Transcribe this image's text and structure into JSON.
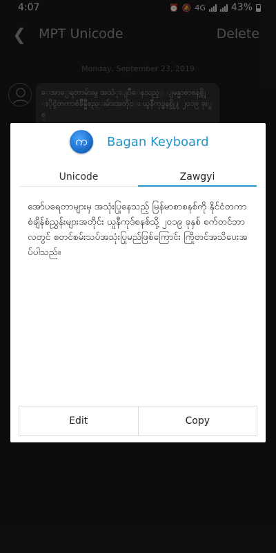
{
  "status_bar": {
    "time": "4:07",
    "network": "4G",
    "battery": "43%"
  },
  "app_bar": {
    "back_icon": "arrow-left-icon",
    "title": "MPT Unicode",
    "delete_label": "Delete"
  },
  "conversation": {
    "date": "Monday, September 23, 2019",
    "message_preview": "ေအာ္ပေရတာမ်ားမွ အသံုးျပဳေနသည့္ ျမန္မာစာစနစ္ကို ႏိုင္ငံတကာစံခ်ိန္မီစည္းမ်ားအတိုင္း ယူနီကုဒ္စနစ္သို႔ ၂၀၁၉ ခုႏွစ္"
  },
  "dialog": {
    "logo_glyph": "က",
    "title": "Bagan Keyboard",
    "tabs": [
      {
        "label": "Unicode",
        "active": false
      },
      {
        "label": "Zawgyi",
        "active": true
      }
    ],
    "converted_text": "အော်ပရေတာများမှ အသုံးပြုနေသည့် မြန်မာစာစနစ်ကို နိုင်ငံတကာစံချိန်စံညွှန်းများအတိုင်း ယူနီကုဒ်စနစ်သို့ ၂၀၁၉ ခုနှစ် စက်တင်ဘာလတွင် စတင်စမ်းသပ်အသုံးပြုမည်ဖြစ်ကြောင်း ကြိုတင်အသိပေးအပ်ပါသည်။",
    "edit_label": "Edit",
    "copy_label": "Copy"
  },
  "colors": {
    "accent": "#2196c9",
    "background": "#191919",
    "dialog_bg": "#ffffff"
  }
}
